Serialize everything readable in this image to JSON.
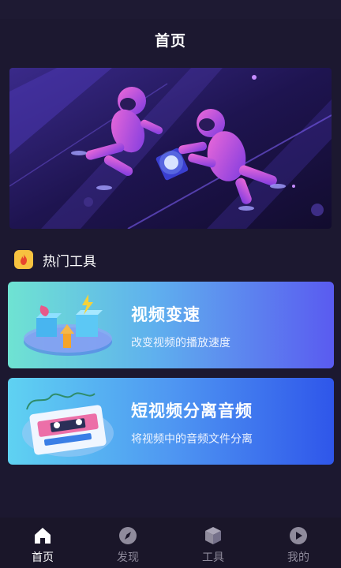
{
  "header": {
    "title": "首页"
  },
  "section": {
    "title": "热门工具",
    "icon": "flame-icon"
  },
  "cards": [
    {
      "title": "视频变速",
      "subtitle": "改变视频的播放速度",
      "icon": "speed-boxes-illustration"
    },
    {
      "title": "短视频分离音频",
      "subtitle": "将视频中的音频文件分离",
      "icon": "cassette-tape-illustration"
    }
  ],
  "tabs": [
    {
      "label": "首页",
      "icon": "home-icon",
      "active": true
    },
    {
      "label": "发现",
      "icon": "compass-icon",
      "active": false
    },
    {
      "label": "工具",
      "icon": "cube-icon",
      "active": false
    },
    {
      "label": "我的",
      "icon": "play-circle-icon",
      "active": false
    }
  ],
  "colors": {
    "background": "#1c1830",
    "accent": "#f7c240",
    "tab_active": "#ffffff",
    "tab_inactive": "#8f8b9c"
  }
}
